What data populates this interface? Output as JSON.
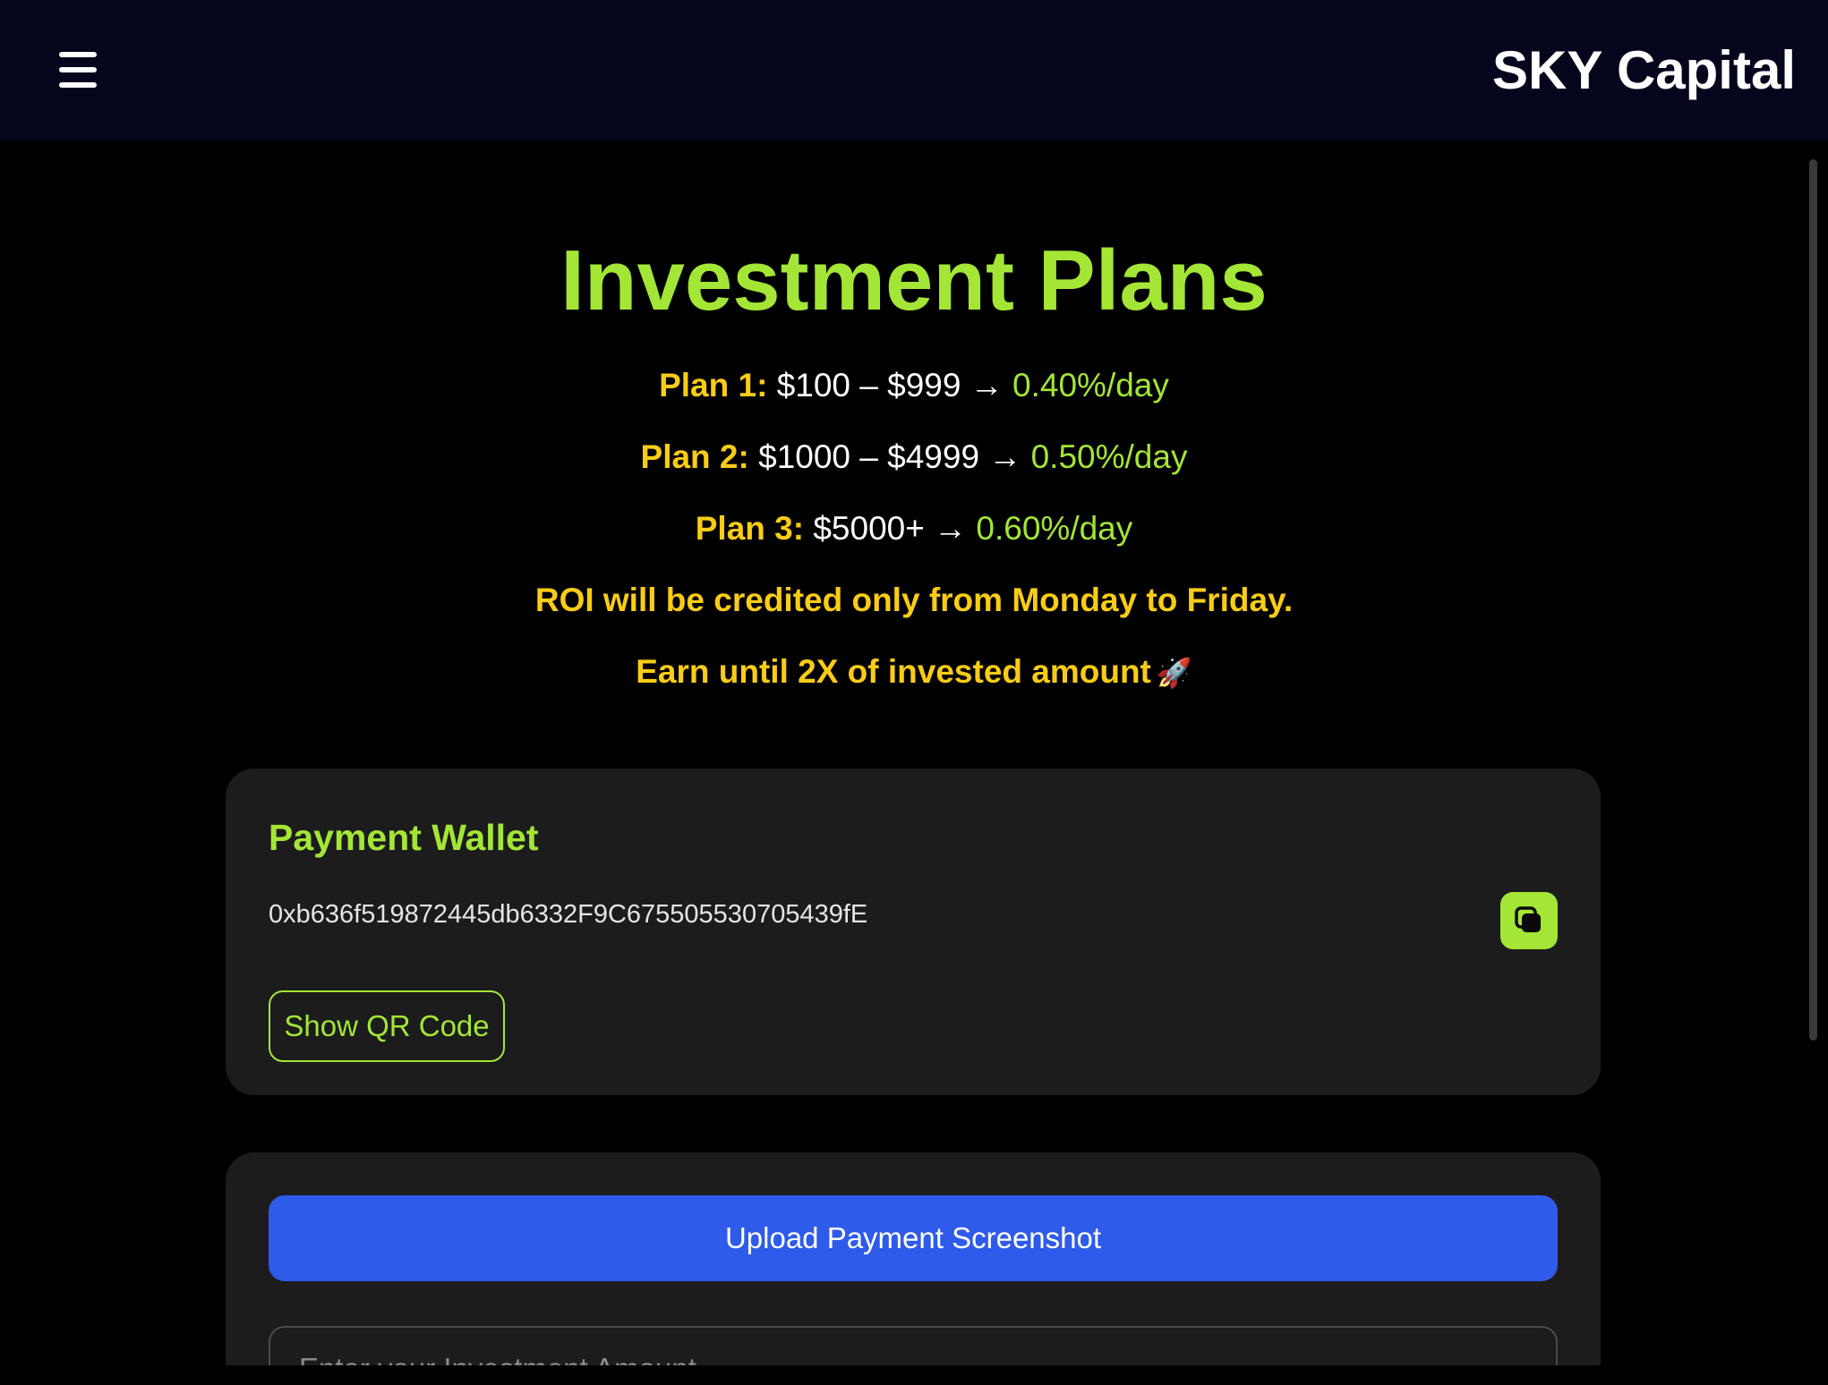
{
  "header": {
    "brand": "SKY Capital",
    "menu_icon": "hamburger-menu-icon"
  },
  "main": {
    "title": "Investment Plans",
    "plans": [
      {
        "name": "Plan 1:",
        "range": "$100 – $999",
        "arrow": "→",
        "rate": "0.40%/day"
      },
      {
        "name": "Plan 2:",
        "range": "$1000 – $4999",
        "arrow": "→",
        "rate": "0.50%/day"
      },
      {
        "name": "Plan 3:",
        "range": "$5000+",
        "arrow": "→",
        "rate": "0.60%/day"
      }
    ],
    "roi_notice": "ROI will be credited only from Monday to Friday.",
    "earn_notice": "Earn until 2X of invested amount",
    "earn_emoji": "🚀"
  },
  "wallet": {
    "title": "Payment Wallet",
    "address": "0xb636f519872445db6332F9C675505530705439fE",
    "copy_icon": "copy-icon",
    "qr_button": "Show QR Code"
  },
  "upload": {
    "button": "Upload Payment Screenshot",
    "amount_placeholder": "Enter your Investment Amount"
  },
  "colors": {
    "accent_green": "#a3e635",
    "accent_yellow": "#facc15",
    "header_bg": "#05061e",
    "card_bg": "#1c1c1c",
    "primary_blue": "#2f5bea"
  }
}
